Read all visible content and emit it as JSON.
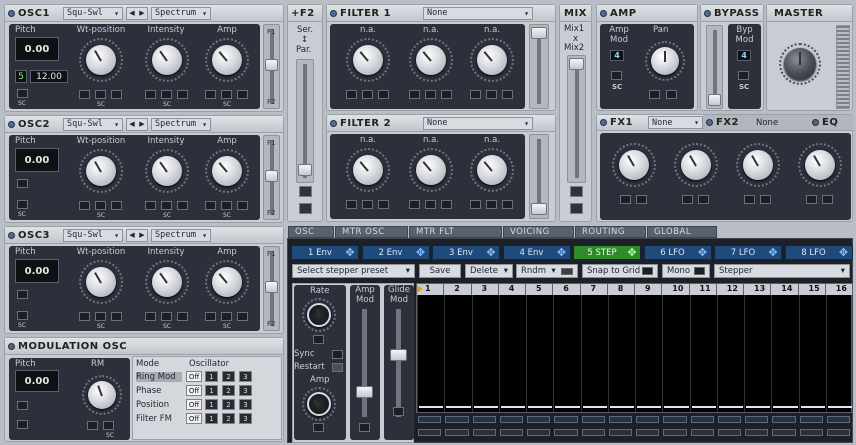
{
  "osc1": {
    "title": "OSC1",
    "wave": "Squ-Swl",
    "mode": "Spectrum",
    "labels": [
      "Pitch",
      "Wt-position",
      "Intensity",
      "Amp"
    ],
    "pitch": "0.00",
    "voices": "5",
    "detune": "12.00",
    "f_top": "F1",
    "f_bot": "F2",
    "sc": "SC"
  },
  "osc2": {
    "title": "OSC2",
    "wave": "Squ-Swl",
    "mode": "Spectrum",
    "labels": [
      "Pitch",
      "Wt-position",
      "Intensity",
      "Amp"
    ],
    "pitch": "0.00",
    "f_top": "F1",
    "f_bot": "F2",
    "sc": "SC"
  },
  "osc3": {
    "title": "OSC3",
    "wave": "Squ-Swl",
    "mode": "Spectrum",
    "labels": [
      "Pitch",
      "Wt-position",
      "Intensity",
      "Amp"
    ],
    "pitch": "0.00",
    "f_top": "F1",
    "f_bot": "F2",
    "sc": "SC"
  },
  "modosc": {
    "title": "MODULATION OSC",
    "pitch_label": "Pitch",
    "rm_label": "RM",
    "pitch": "0.00",
    "mode_hdr": "Mode",
    "osc_hdr": "Oscillator",
    "rows": [
      "Ring Mod",
      "Phase",
      "Position",
      "Filter FM"
    ],
    "off": "Off",
    "nums": [
      "1",
      "2",
      "3"
    ],
    "sc": "SC"
  },
  "f2": {
    "title": "+F2",
    "ser": "Ser.",
    "arrow": "↕",
    "par": "Par."
  },
  "filter1": {
    "title": "FILTER 1",
    "type": "None",
    "labels": [
      "n.a.",
      "n.a.",
      "n.a."
    ]
  },
  "filter2": {
    "title": "FILTER 2",
    "type": "None",
    "labels": [
      "n.a.",
      "n.a.",
      "n.a."
    ]
  },
  "mix": {
    "title": "MIX",
    "m1": "Mix1",
    "x": "x",
    "m2": "Mix2"
  },
  "amp": {
    "title": "AMP",
    "amp_mod": "Amp Mod",
    "pan": "Pan",
    "val": "4",
    "sc": "SC"
  },
  "bypass": {
    "title": "BYPASS",
    "byp_mod": "Byp Mod",
    "val": "4",
    "sc": "SC"
  },
  "master": {
    "title": "MASTER"
  },
  "fx1": {
    "title": "FX1",
    "type": "None"
  },
  "fx2": {
    "title": "FX2",
    "type": "None"
  },
  "eq": {
    "title": "EQ"
  },
  "tabs": [
    "OSC",
    "MTR OSC",
    "MTR FLT",
    "VOICING",
    "ROUTING",
    "GLOBAL"
  ],
  "envs": [
    "1 Env",
    "2 Env",
    "3 Env",
    "4 Env",
    "5 STEP",
    "6 LFO",
    "7 LFO",
    "8 LFO"
  ],
  "stepper": {
    "preset": "Select stepper preset",
    "save": "Save",
    "delete": "Delete",
    "rndm": "Rndm",
    "snap": "Snap to Grid",
    "mono": "Mono",
    "type": "Stepper",
    "rate": "Rate",
    "sync": "Sync",
    "restart": "Restart",
    "amp": "Amp",
    "amp_mod": "Amp Mod",
    "glide_mod": "Glide Mod",
    "steps": [
      "1",
      "2",
      "3",
      "4",
      "5",
      "6",
      "7",
      "8",
      "9",
      "10",
      "11",
      "12",
      "13",
      "14",
      "15",
      "16"
    ]
  }
}
